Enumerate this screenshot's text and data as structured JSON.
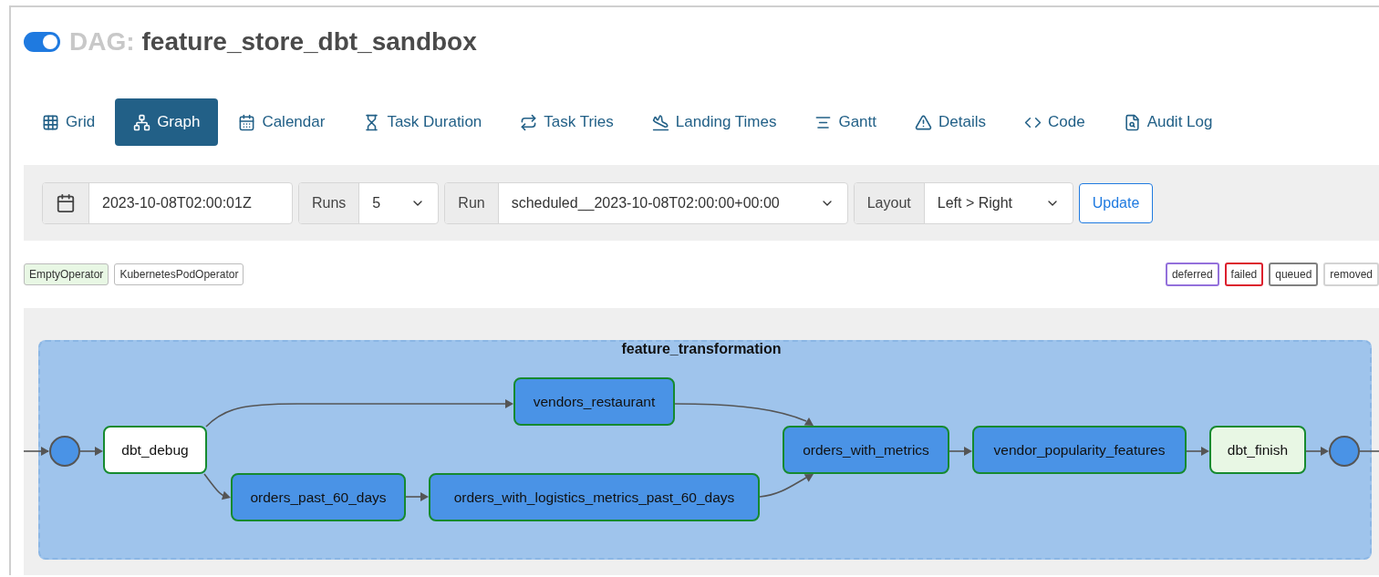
{
  "header": {
    "toggle": {
      "on": true
    },
    "prefix": "DAG:",
    "title": "feature_store_dbt_sandbox"
  },
  "tabs": [
    {
      "label": "Grid",
      "selected": false
    },
    {
      "label": "Graph",
      "selected": true
    },
    {
      "label": "Calendar",
      "selected": false
    },
    {
      "label": "Task Duration",
      "selected": false
    },
    {
      "label": "Task Tries",
      "selected": false
    },
    {
      "label": "Landing Times",
      "selected": false
    },
    {
      "label": "Gantt",
      "selected": false
    },
    {
      "label": "Details",
      "selected": false
    },
    {
      "label": "Code",
      "selected": false
    },
    {
      "label": "Audit Log",
      "selected": false
    }
  ],
  "toolbar": {
    "base_date": "2023-10-08T02:00:01Z",
    "runs_label": "Runs",
    "runs_value": "5",
    "run_label": "Run",
    "run_value": "scheduled__2023-10-08T02:00:00+00:00",
    "layout_label": "Layout",
    "layout_value": "Left > Right",
    "update_button": "Update"
  },
  "operator_legend": [
    {
      "label": "EmptyOperator",
      "color": "#e8f7e4"
    },
    {
      "label": "KubernetesPodOperator",
      "color": "#ffffff"
    }
  ],
  "state_legend": [
    {
      "label": "deferred",
      "color": "#9370db"
    },
    {
      "label": "failed",
      "color": "#dc1f2d"
    },
    {
      "label": "queued",
      "color": "#808080"
    },
    {
      "label": "removed",
      "color": "#d3d3d3"
    }
  ],
  "graph": {
    "group": "feature_transformation",
    "nodes": [
      {
        "kind": "join"
      },
      {
        "kind": "task",
        "label": "dbt_debug",
        "color": "#ffffff"
      },
      {
        "kind": "task",
        "label": "vendors_restaurant",
        "color": "#4a93e6"
      },
      {
        "kind": "task",
        "label": "orders_past_60_days",
        "color": "#4a93e6"
      },
      {
        "kind": "task",
        "label": "orders_with_logistics_metrics_past_60_days",
        "color": "#4a93e6"
      },
      {
        "kind": "task",
        "label": "orders_with_metrics",
        "color": "#4a93e6"
      },
      {
        "kind": "task",
        "label": "vendor_popularity_features",
        "color": "#4a93e6"
      },
      {
        "kind": "task",
        "label": "dbt_finish",
        "color": "#e8f7e4"
      },
      {
        "kind": "join"
      }
    ]
  }
}
